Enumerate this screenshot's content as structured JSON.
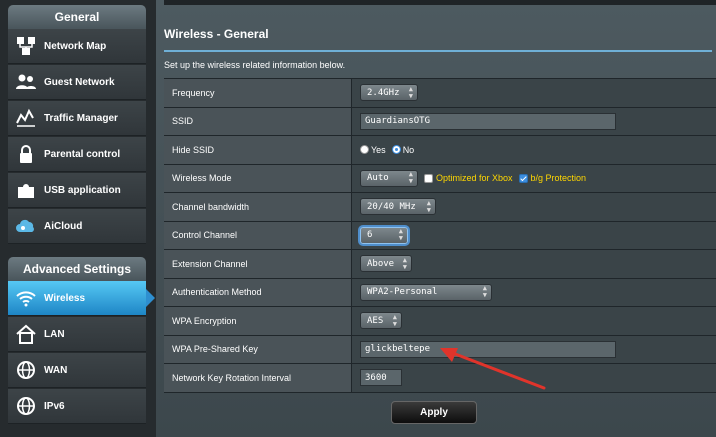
{
  "sidebar": {
    "general_header": "General",
    "general_items": [
      {
        "label": "Network Map",
        "icon": "network-map-icon"
      },
      {
        "label": "Guest Network",
        "icon": "guest-network-icon"
      },
      {
        "label": "Traffic Manager",
        "icon": "traffic-manager-icon"
      },
      {
        "label": "Parental control",
        "icon": "lock-icon"
      },
      {
        "label": "USB application",
        "icon": "puzzle-icon"
      },
      {
        "label": "AiCloud",
        "icon": "cloud-icon"
      }
    ],
    "advanced_header": "Advanced Settings",
    "advanced_items": [
      {
        "label": "Wireless",
        "icon": "wifi-icon",
        "active": true
      },
      {
        "label": "LAN",
        "icon": "house-icon"
      },
      {
        "label": "WAN",
        "icon": "globe-icon"
      },
      {
        "label": "IPv6",
        "icon": "globe-icon"
      }
    ]
  },
  "main": {
    "title": "Wireless - General",
    "description": "Set up the wireless related information below.",
    "rows": {
      "frequency": {
        "label": "Frequency",
        "value": "2.4GHz"
      },
      "ssid": {
        "label": "SSID",
        "value": "GuardiansOTG"
      },
      "hide_ssid": {
        "label": "Hide SSID",
        "yes": "Yes",
        "no": "No",
        "selected": "No"
      },
      "wireless_mode": {
        "label": "Wireless Mode",
        "value": "Auto",
        "opt_xbox": "Optimized for Xbox",
        "opt_bg": "b/g Protection",
        "xbox_checked": false,
        "bg_checked": true
      },
      "channel_bandwidth": {
        "label": "Channel bandwidth",
        "value": "20/40 MHz"
      },
      "control_channel": {
        "label": "Control Channel",
        "value": "6"
      },
      "extension_channel": {
        "label": "Extension Channel",
        "value": "Above"
      },
      "auth_method": {
        "label": "Authentication Method",
        "value": "WPA2-Personal"
      },
      "wpa_encryption": {
        "label": "WPA Encryption",
        "value": "AES"
      },
      "wpa_key": {
        "label": "WPA Pre-Shared Key",
        "value": "glickbeltepe"
      },
      "rotation_interval": {
        "label": "Network Key Rotation Interval",
        "value": "3600"
      }
    },
    "apply_label": "Apply"
  },
  "colors": {
    "accent": "#1e86c6",
    "warning": "#ffd700",
    "annotation_arrow": "#e0342b"
  }
}
